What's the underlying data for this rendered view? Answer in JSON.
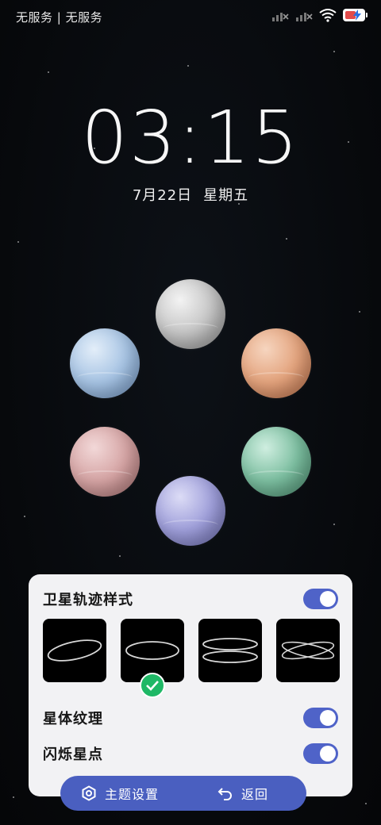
{
  "status_bar": {
    "carrier": "无服务 | 无服务",
    "icons": [
      "signal-off-icon",
      "signal-off-icon",
      "wifi-icon",
      "battery-charging-icon"
    ]
  },
  "lockscreen": {
    "time": "03:15",
    "date": "7月22日",
    "weekday": "星期五"
  },
  "planets": [
    {
      "name": "gray-planet",
      "color": "#c9c9c9"
    },
    {
      "name": "orange-planet",
      "color": "#e3a37d"
    },
    {
      "name": "blue-planet",
      "color": "#a6c3e3"
    },
    {
      "name": "pink-planet",
      "color": "#d5a4a4"
    },
    {
      "name": "green-planet",
      "color": "#7cbea0"
    },
    {
      "name": "purple-planet",
      "color": "#9f9fda"
    }
  ],
  "settings_panel": {
    "orbit_style_label": "卫星轨迹样式",
    "orbit_style_enabled": true,
    "orbit_styles": [
      "tilted-ring-icon",
      "flat-ring-icon",
      "double-ring-icon",
      "crossed-rings-icon"
    ],
    "selected_orbit_style": 1,
    "texture_label": "星体纹理",
    "texture_enabled": true,
    "twinkle_label": "闪烁星点",
    "twinkle_enabled": true
  },
  "bottom_bar": {
    "theme_label": "主题设置",
    "back_label": "返回"
  },
  "colors": {
    "accent": "#4f63c8",
    "bottom_bar": "#4a5fc0",
    "selected_check": "#1fb866",
    "panel_bg": "#f2f2f4",
    "battery_low": "#e24b4b"
  }
}
